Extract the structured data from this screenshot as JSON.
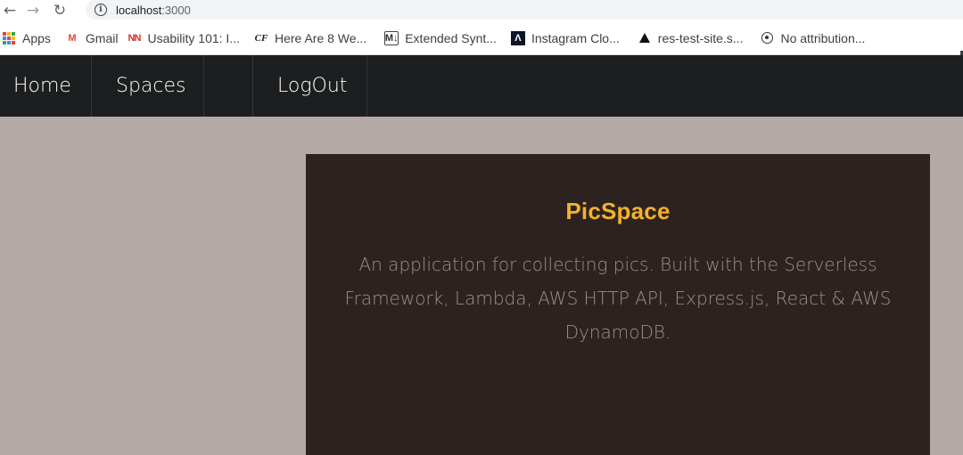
{
  "browser": {
    "url_host": "localhost",
    "url_port": ":3000",
    "bookmarks": [
      {
        "icon": "apps-grid-icon",
        "label": "Apps"
      },
      {
        "icon": "gmail-icon",
        "label": "Gmail"
      },
      {
        "icon": "nn-icon",
        "label": "Usability 101: I..."
      },
      {
        "icon": "cf-icon",
        "label": "Here Are 8 We..."
      },
      {
        "icon": "markdown-icon",
        "label": "Extended Synt..."
      },
      {
        "icon": "instagram-clone-icon",
        "label": "Instagram Clo..."
      },
      {
        "icon": "triangle-icon",
        "label": "res-test-site.s..."
      },
      {
        "icon": "attribution-icon",
        "label": "No attribution..."
      }
    ]
  },
  "nav": {
    "home": "Home",
    "spaces": "Spaces",
    "logout": "LogOut"
  },
  "hero": {
    "title": "PicSpace",
    "description": "An application for collecting pics. Built with the Serverless Framework, Lambda, AWS HTTP API, Express.js, React & AWS DynamoDB."
  },
  "colors": {
    "page_bg": "#b5a9a7",
    "navbar_bg": "#1c1e1f",
    "card_bg": "#2c2321",
    "title_accent": "#f4b12d",
    "desc_text": "#9a8f8c"
  }
}
